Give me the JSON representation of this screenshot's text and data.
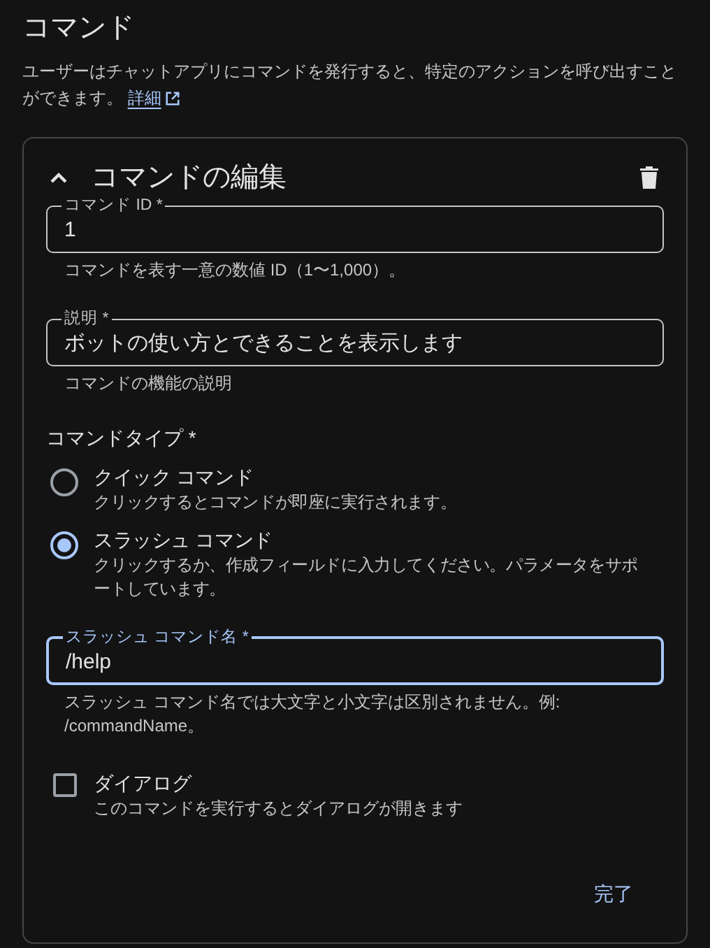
{
  "page": {
    "title": "コマンド",
    "description": "ユーザーはチャットアプリにコマンドを発行すると、特定のアクションを呼び出すことができます。",
    "learn_more_link": "詳細"
  },
  "card": {
    "title": "コマンドの編集",
    "expanded": true,
    "fields": [
      {
        "label": "コマンド ID *",
        "value": "1",
        "helper": "コマンドを表す一意の数値 ID（1〜1,000）。",
        "focused": false
      },
      {
        "label": "説明 *",
        "value": "ボットの使い方とできることを表示します",
        "helper": "コマンドの機能の説明",
        "focused": false
      }
    ],
    "command_type": {
      "label": "コマンドタイプ *",
      "options": [
        {
          "label": "クイック コマンド",
          "description": "クリックするとコマンドが即座に実行されます。",
          "selected": false
        },
        {
          "label": "スラッシュ コマンド",
          "description": "クリックするか、作成フィールドに入力してください。パラメータをサポートしています。",
          "selected": true
        }
      ]
    },
    "slash_command_name": {
      "label": "スラッシュ コマンド名 *",
      "value": "/help",
      "helper": "スラッシュ コマンド名では大文字と小文字は区別されません。例: /commandName。",
      "focused": true
    },
    "dialog": {
      "label": "ダイアログ",
      "description": "このコマンドを実行するとダイアログが開きます",
      "checked": false
    },
    "done_button": "完了"
  }
}
